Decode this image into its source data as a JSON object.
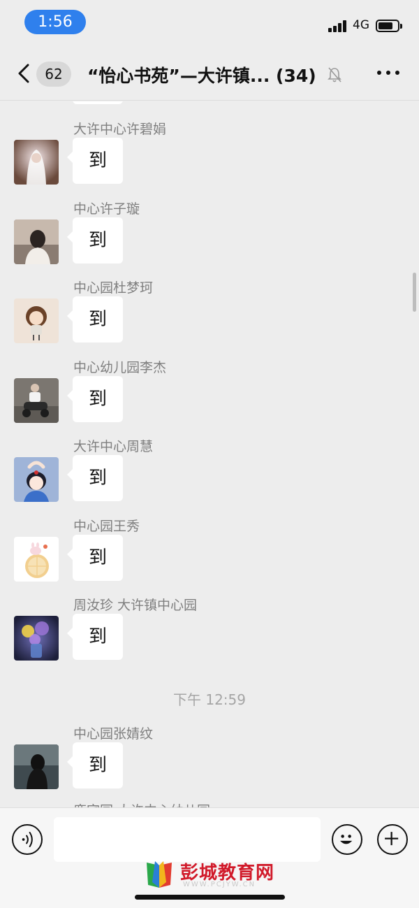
{
  "status_bar": {
    "time": "1:56",
    "network": "4G",
    "battery_level": 0.75
  },
  "header": {
    "back_count": "62",
    "title": "“怡心书苑”—大许镇... (34)"
  },
  "messages": [
    {
      "sender": "大许中心许碧娟",
      "text": "到"
    },
    {
      "sender": "中心许子璇",
      "text": "到"
    },
    {
      "sender": "中心园杜梦珂",
      "text": "到"
    },
    {
      "sender": "中心幼儿园李杰",
      "text": "到"
    },
    {
      "sender": "大许中心周慧",
      "text": "到"
    },
    {
      "sender": "中心园王秀",
      "text": "到"
    },
    {
      "sender": "周汝珍  大许镇中心园",
      "text": "到"
    },
    {
      "sender": "中心园张婧纹",
      "text": "到"
    }
  ],
  "time_divider": "下午 12:59",
  "cut_off_sender": "鹿宾园 大许中心幼儿园",
  "input": {
    "value": ""
  },
  "watermark": {
    "text": "彭城教育网",
    "subtext": "WWW.PCJYW.CN"
  },
  "colors": {
    "background": "#ededed",
    "bubble": "#ffffff",
    "time_pill": "#2f80ed",
    "watermark": "#d11a2a"
  }
}
